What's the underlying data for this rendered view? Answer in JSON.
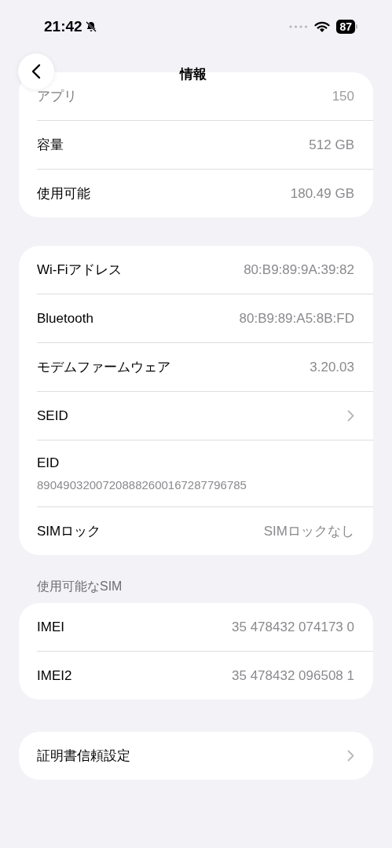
{
  "status_bar": {
    "time": "21:42",
    "battery": "87"
  },
  "nav": {
    "title": "情報"
  },
  "sections": [
    {
      "rows": [
        {
          "kind": "value",
          "label": "アプリ",
          "value": "150",
          "dimmed": true
        },
        {
          "kind": "value",
          "label": "容量",
          "value": "512 GB",
          "dimmed": false
        },
        {
          "kind": "value",
          "label": "使用可能",
          "value": "180.49 GB",
          "dimmed": false
        }
      ]
    },
    {
      "rows": [
        {
          "kind": "value",
          "label": "Wi-Fiアドレス",
          "value": "80:B9:89:9A:39:82",
          "dimmed": false
        },
        {
          "kind": "value",
          "label": "Bluetooth",
          "value": "80:B9:89:A5:8B:FD",
          "dimmed": false
        },
        {
          "kind": "value",
          "label": "モデムファームウェア",
          "value": "3.20.03",
          "dimmed": false
        },
        {
          "kind": "chevron",
          "label": "SEID",
          "dimmed": false
        },
        {
          "kind": "stacked",
          "label": "EID",
          "value": "89049032007208882600167287796785",
          "dimmed": false
        },
        {
          "kind": "value",
          "label": "SIMロック",
          "value": "SIMロックなし",
          "dimmed": false
        }
      ]
    },
    {
      "header": "使用可能なSIM",
      "rows": [
        {
          "kind": "value",
          "label": "IMEI",
          "value": "35 478432 074173 0",
          "dimmed": false
        },
        {
          "kind": "value",
          "label": "IMEI2",
          "value": "35 478432 096508 1",
          "dimmed": false
        }
      ]
    },
    {
      "rows": [
        {
          "kind": "chevron",
          "label": "証明書信頼設定",
          "dimmed": false
        }
      ]
    }
  ]
}
